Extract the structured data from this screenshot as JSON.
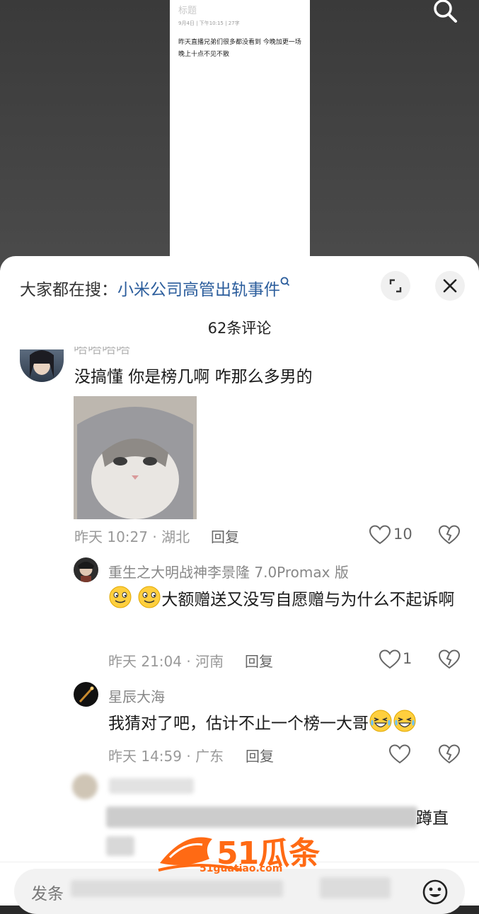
{
  "video_note": {
    "title": "标题",
    "meta": "9月4日 | 下午10:15 | 27字",
    "body": "昨天直播兄弟们很多都没看到 今晚加更一场 晚上十点不见不散"
  },
  "search_suggest": {
    "prefix": "大家都在搜：",
    "keyword": "小米公司高管出轨事件"
  },
  "comment_count": "62条评论",
  "comments": [
    {
      "username": "嗒嗒嗒嗒",
      "text": "没搞懂 你是榜几啊 咋那么多男的",
      "time_location": "昨天 10:27 · 湖北",
      "reply_label": "回复",
      "likes": "10"
    },
    {
      "username": "重生之大明战神李景隆 7.0Promax 版",
      "text": "大额赠送又没写自愿赠与为什么不起诉啊",
      "time_location": "昨天 21:04 · 河南",
      "reply_label": "回复",
      "likes": "1"
    },
    {
      "username": "星辰大海",
      "text": "我猜对了吧，估计不止一个榜一大哥",
      "time_location": "昨天 14:59 · 广东",
      "reply_label": "回复",
      "likes": ""
    }
  ],
  "blurred_comment_tail": "蹲直",
  "input": {
    "placeholder": "发条"
  },
  "watermark": {
    "brand": "51瓜条",
    "url": "51guatiao.com"
  },
  "icons": [
    "search-icon",
    "expand-icon",
    "close-icon",
    "heart-icon",
    "broken-heart-icon",
    "emoji-icon",
    "smile-emoji-icon",
    "laugh-cry-emoji-icon"
  ]
}
